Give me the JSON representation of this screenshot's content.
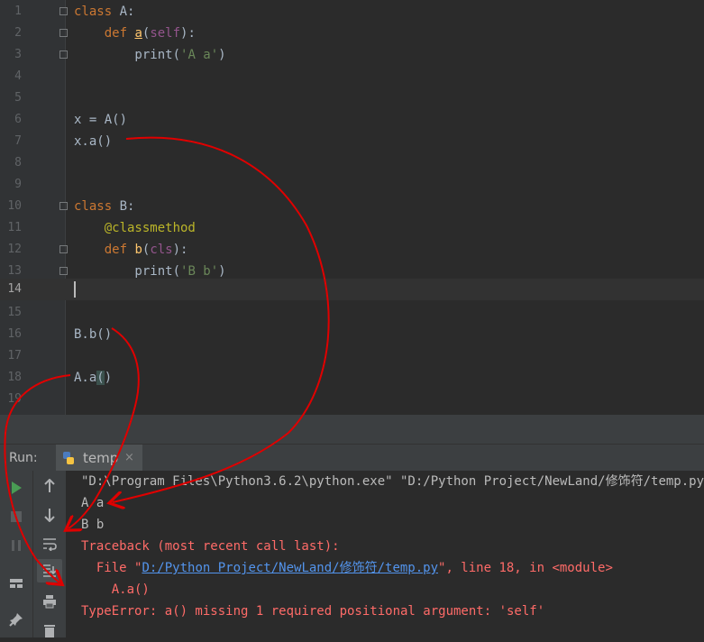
{
  "editor": {
    "lines": [
      {
        "n": "1",
        "t": "class A:"
      },
      {
        "n": "2",
        "t": "    def a(self):"
      },
      {
        "n": "3",
        "t": "        print('A a')"
      },
      {
        "n": "4",
        "t": ""
      },
      {
        "n": "5",
        "t": ""
      },
      {
        "n": "6",
        "t": "x = A()"
      },
      {
        "n": "7",
        "t": "x.a()"
      },
      {
        "n": "8",
        "t": ""
      },
      {
        "n": "9",
        "t": ""
      },
      {
        "n": "10",
        "t": "class B:"
      },
      {
        "n": "11",
        "t": "    @classmethod"
      },
      {
        "n": "12",
        "t": "    def b(cls):"
      },
      {
        "n": "13",
        "t": "        print('B b')"
      },
      {
        "n": "14",
        "t": ""
      },
      {
        "n": "15",
        "t": ""
      },
      {
        "n": "16",
        "t": "B.b()"
      },
      {
        "n": "17",
        "t": ""
      },
      {
        "n": "18",
        "t": "A.a()"
      },
      {
        "n": "19",
        "t": ""
      }
    ]
  },
  "run": {
    "label": "Run:",
    "tab": "temp",
    "close": "×"
  },
  "console": {
    "cmd": "\"D:\\Program Files\\Python3.6.2\\python.exe\" \"D:/Python Project/NewLand/修饰符/temp.py\"",
    "out1": "A a",
    "out2": "B b",
    "tb": "Traceback (most recent call last):",
    "file_prefix": "  File \"",
    "file_link": "D:/Python Project/NewLand/修饰符/temp.py",
    "file_suffix": "\", line 18, in <module>",
    "src": "    A.a()",
    "err": "TypeError: a() missing 1 required positional argument: 'self'"
  },
  "colors": {
    "background": "#2b2b2b",
    "keyword": "#cc7832",
    "function": "#ffc66d",
    "string": "#6a8759",
    "decorator": "#bbb529",
    "error": "#ff6b68",
    "link": "#5394ec",
    "annotation": "#e00000"
  }
}
